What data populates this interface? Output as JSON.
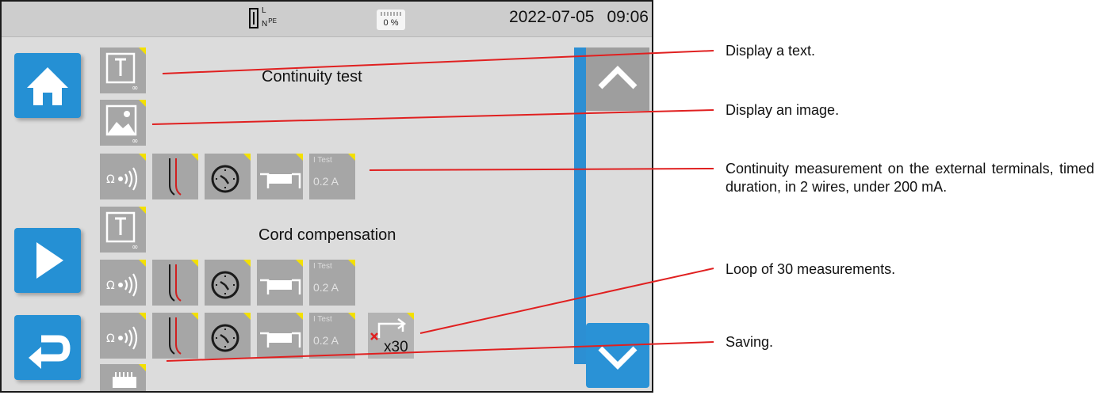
{
  "status_bar": {
    "terminal_indicator": {
      "top": "L",
      "bottom": "N",
      "pe": "PE"
    },
    "memory_usage": "0 %",
    "date": "2022-07-05",
    "time": "09:06"
  },
  "sequence_steps": {
    "step1_text": "Continuity test",
    "step2_text": "Cord compensation"
  },
  "measurement_tiles": {
    "current_label": "I Test",
    "current_value": "0.2 A",
    "loop_count": "x30"
  },
  "annotations": [
    "Display a text.",
    "Display an image.",
    "Continuity measurement on the external terminals, timed duration, in 2 wires, under 200 mA.",
    "Loop of 30 measurements.",
    "Saving."
  ],
  "colors": {
    "accent_blue": "#2590d4",
    "tile_gray": "#a6a6a6",
    "corner_yellow": "#f3e000",
    "leader_red": "#e02020",
    "screen_bg": "#dcdcdc"
  },
  "icons": [
    "home-icon",
    "play-icon",
    "back-icon",
    "text-step-icon",
    "image-step-icon",
    "buzzer-icon",
    "two-wire-icon",
    "timer-icon",
    "terminal-connection-icon",
    "loop-icon",
    "save-memory-icon",
    "chevron-up-icon",
    "chevron-down-icon"
  ]
}
